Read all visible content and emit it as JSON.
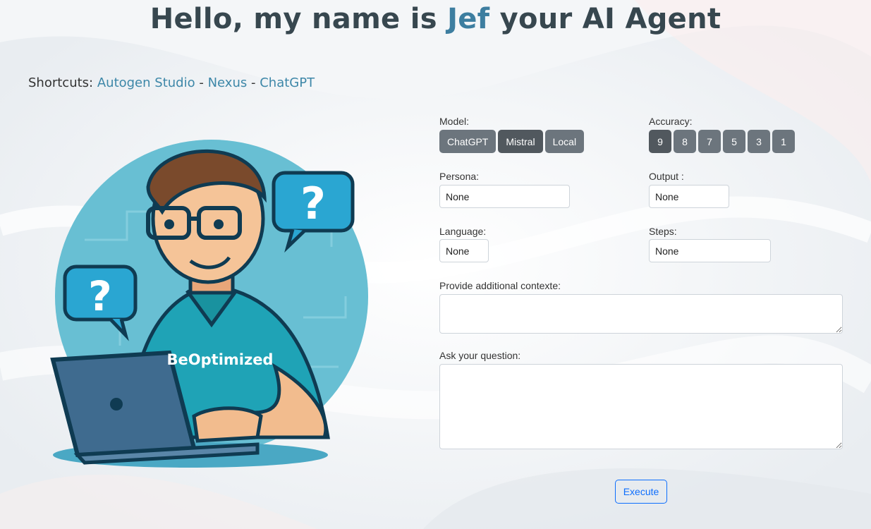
{
  "header": {
    "title_prefix": "Hello, my name is ",
    "title_name": "Jef",
    "title_suffix": " your AI Agent"
  },
  "shortcuts": {
    "label": "Shortcuts:",
    "links": [
      "Autogen Studio",
      "Nexus",
      "ChatGPT"
    ],
    "separator": "-"
  },
  "hero": {
    "shirt_text": "BeOptimized",
    "bubble_mark": "?"
  },
  "form": {
    "model": {
      "label": "Model:",
      "options": [
        "ChatGPT",
        "Mistral",
        "Local"
      ],
      "selected": "Mistral"
    },
    "accuracy": {
      "label": "Accuracy:",
      "options": [
        "9",
        "8",
        "7",
        "5",
        "3",
        "1"
      ],
      "selected": "9"
    },
    "persona": {
      "label": "Persona:",
      "value": "None"
    },
    "output": {
      "label": "Output :",
      "value": "None"
    },
    "language": {
      "label": "Language:",
      "value": "None"
    },
    "steps": {
      "label": "Steps:",
      "value": "None"
    },
    "context": {
      "label": "Provide additional contexte:",
      "value": ""
    },
    "question": {
      "label": "Ask your question:",
      "value": ""
    },
    "execute_label": "Execute"
  },
  "colors": {
    "title": "#37474f",
    "accent": "#3d7ea0",
    "link": "#3d87a8",
    "button": "#6c757d",
    "button_active": "#51585e",
    "execute": "#0d6efd"
  }
}
